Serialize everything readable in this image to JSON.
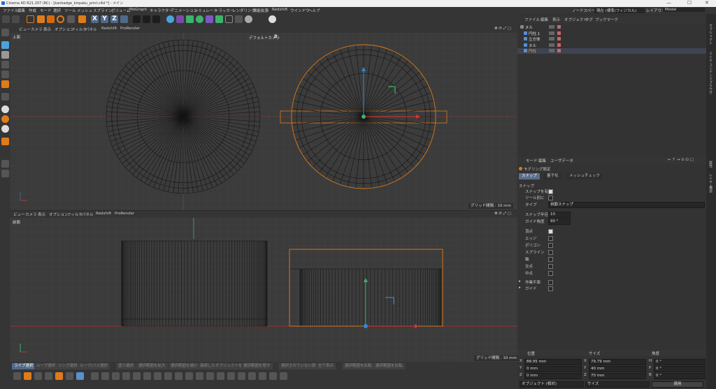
{
  "window": {
    "title": "Cinema 4D R21.207 (RC) - [kanbadge_kinpaku_print.c4d *] - メイン",
    "min": "—",
    "max": "☐",
    "close": "✕"
  },
  "menu": [
    "ファイル",
    "編集",
    "作成",
    "モード",
    "選択",
    "ツール",
    "メッシュ",
    "スプライン",
    "ボリューム",
    "MoGraph",
    "キャラクター",
    "アニメーション",
    "シミュレート",
    "トラッカー",
    "レンダリング",
    "機能拡張",
    "Redshift",
    "ウインドウ",
    "ヘルプ"
  ],
  "menu_right": {
    "nodespace_label": "ノードスペース:",
    "nodespace_value": "現在 (標準/フィジカル)",
    "layout_label": "レイアウト:",
    "layout_value": "Model"
  },
  "toolbar": {
    "axes": [
      "X",
      "Y",
      "Z"
    ],
    "colors": {
      "blue": "#4aa3df",
      "orange": "#e07b1a",
      "green": "#3db36b",
      "accent": "#5a8fd0"
    }
  },
  "viewport_top": {
    "menu": [
      "ビュー",
      "カメラ",
      "表示",
      "オプション",
      "フィルタ",
      "パネル",
      "Redshift",
      "ProRender"
    ],
    "label": "上面",
    "camera": "デフォルトカメラ",
    "camera_icon": "camera-icon",
    "grid": "グリッド間隔 : 10 mm"
  },
  "viewport_front": {
    "menu": [
      "ビュー",
      "カメラ",
      "表示",
      "オプション",
      "フィルタ",
      "パネル",
      "Redshift",
      "ProRender"
    ],
    "label": "前面",
    "grid": "グリッド間隔 : 10 mm"
  },
  "object_manager": {
    "menu": [
      "ファイル",
      "編集",
      "表示",
      "オブジェクト",
      "タグ",
      "ブックマーク"
    ],
    "objects": [
      {
        "name": "ヌル",
        "indent": 0,
        "selected": false
      },
      {
        "name": "円柱.1",
        "indent": 1,
        "selected": false
      },
      {
        "name": "立方体",
        "indent": 1,
        "selected": false
      },
      {
        "name": "ヌル",
        "indent": 1,
        "selected": false
      },
      {
        "name": "円柱",
        "indent": 1,
        "selected": true
      }
    ]
  },
  "attributes": {
    "menu": [
      "モード",
      "編集",
      "ユーザデータ"
    ],
    "title": "モデリング設定",
    "tabs": [
      "スナップ",
      "量子化",
      "メッシュチェック"
    ],
    "section": "スナップ",
    "enable_label": "スナップを有効",
    "per_tool_label": "ツール別に",
    "type_label": "タイプ",
    "type_value": "自動スナップ",
    "radius_label": "スナップ半径",
    "radius_value": "10",
    "guide_angle_label": "ガイド角度",
    "guide_angle_value": "90 °",
    "items": [
      {
        "label": "頂点",
        "on": true
      },
      {
        "label": "エッジ",
        "on": false
      },
      {
        "label": "ポリゴン",
        "on": false
      },
      {
        "label": "スプライン",
        "on": false
      },
      {
        "label": "軸",
        "on": false
      },
      {
        "label": "交点",
        "on": false
      },
      {
        "label": "中点",
        "on": false
      }
    ],
    "extras": [
      "作業平面",
      "ガイド"
    ]
  },
  "coordinates": {
    "headers": [
      "位置",
      "サイズ",
      "角度"
    ],
    "rows": [
      {
        "axis": "X",
        "pos": "88.95 mm",
        "size_axis": "X",
        "size": "79.79 mm",
        "rot_axis": "H",
        "rot": "0 °"
      },
      {
        "axis": "Y",
        "pos": "0 mm",
        "size_axis": "Y",
        "size": "40 mm",
        "rot_axis": "P",
        "rot": "0 °"
      },
      {
        "axis": "Z",
        "pos": "0 mm",
        "size_axis": "Z",
        "size": "70 mm",
        "rot_axis": "B",
        "rot": "0 °"
      }
    ],
    "mode_value": "オブジェクト (相対)",
    "size_mode": "サイズ",
    "apply": "適用"
  },
  "bottom_buttons": [
    "ライブ選択",
    "ループ選択",
    "リング選択",
    "ループ/パス選択",
    "塗り選択",
    "選択範囲を拡大",
    "選択範囲を縮小",
    "接続したオブジェクトを選択",
    "選択範囲を隠す",
    "選択されていない部分を隠す",
    "全て表示",
    "選択範囲を反転",
    "選択範囲を反転"
  ],
  "side_strip": {
    "top": [
      "オブジェクト",
      "テイク",
      "コンテンツブラウザ"
    ],
    "bottom": [
      "属性",
      "レイヤー",
      "構造"
    ]
  }
}
